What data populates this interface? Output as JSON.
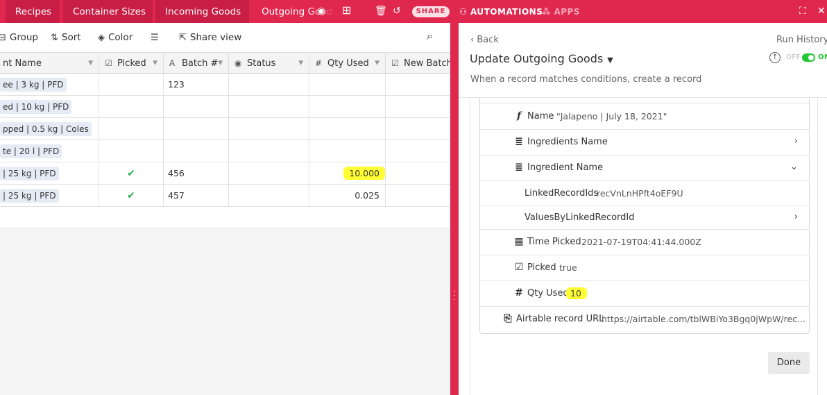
{
  "tabs": [
    "Recipes",
    "Container Sizes",
    "Incoming Goods",
    "Outgoing Goods"
  ],
  "topbar": {
    "share": "SHARE",
    "automations": "AUTOMATIONS",
    "apps": "APPS"
  },
  "toolbar": {
    "group": "Group",
    "sort": "Sort",
    "color": "Color",
    "share_view": "Share view"
  },
  "grid": {
    "columns": [
      "nt Name",
      "Picked",
      "Batch #",
      "Status",
      "Qty Used",
      "New Batch N"
    ],
    "rows": [
      {
        "name": "ee | 3 kg | PFD",
        "picked": "",
        "batch": "123",
        "status": "",
        "qty": ""
      },
      {
        "name": "ed | 10 kg | PFD",
        "picked": "",
        "batch": "",
        "status": "",
        "qty": ""
      },
      {
        "name": "pped | 0.5 kg | Coles",
        "picked": "",
        "batch": "",
        "status": "",
        "qty": ""
      },
      {
        "name": "te | 20 l | PFD",
        "picked": "",
        "batch": "",
        "status": "",
        "qty": ""
      },
      {
        "name": "| 25 kg | PFD",
        "picked": "✔",
        "batch": "456",
        "status": "",
        "qty": "10.000"
      },
      {
        "name": "| 25 kg | PFD",
        "picked": "✔",
        "batch": "457",
        "status": "",
        "qty": "0.025"
      }
    ]
  },
  "panel": {
    "back": "Back",
    "run_history": "Run History",
    "title": "Update Outgoing Goods",
    "description": "When a record matches conditions, create a record",
    "off": "OFF",
    "on": "ON",
    "done": "Done",
    "fields": [
      {
        "icon": "formula-icon",
        "label": "Name",
        "value": "\"Jalapeno | July 18, 2021\""
      },
      {
        "icon": "lookup-icon",
        "label": "Ingredients Name",
        "value": ""
      },
      {
        "icon": "lookup-icon",
        "label": "Ingredient Name",
        "value": ""
      },
      {
        "icon": "",
        "label": "LinkedRecordIds",
        "value": "recVnLnHPft4oEF9U"
      },
      {
        "icon": "",
        "label": "ValuesByLinkedRecordId",
        "value": ""
      },
      {
        "icon": "date-icon",
        "label": "Time Picked",
        "value": "2021-07-19T04:41:44.000Z"
      },
      {
        "icon": "checkbox-icon",
        "label": "Picked",
        "value": "true"
      },
      {
        "icon": "number-icon",
        "label": "Qty Used",
        "value": "10"
      },
      {
        "icon": "link-icon",
        "label": "Airtable record URL",
        "value": "https://airtable.com/tblWBiYo3Bgq0jWpW/rec..."
      }
    ]
  }
}
